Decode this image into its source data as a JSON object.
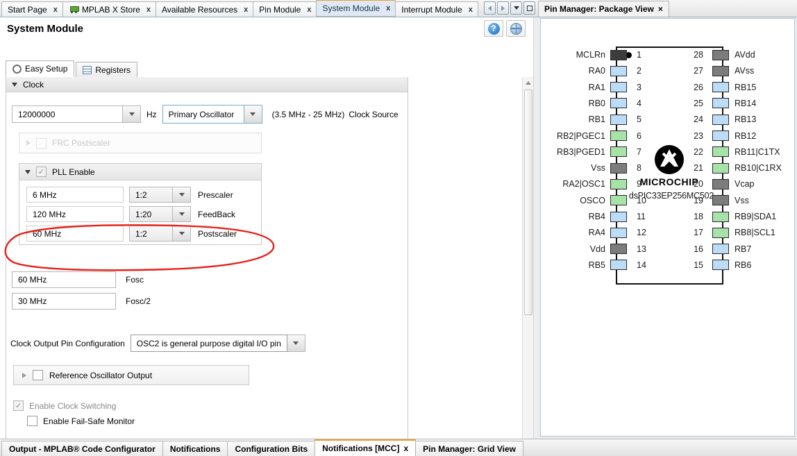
{
  "top_tabs": [
    {
      "label": "Start Page",
      "icon": "",
      "closable": true,
      "active": false
    },
    {
      "label": "MPLAB X Store",
      "icon": "cart-icon",
      "closable": true,
      "active": false
    },
    {
      "label": "Available Resources",
      "icon": "",
      "closable": true,
      "active": false
    },
    {
      "label": "Pin Module",
      "icon": "",
      "closable": true,
      "active": false
    },
    {
      "label": "System Module",
      "icon": "",
      "closable": true,
      "active": true
    },
    {
      "label": "Interrupt Module",
      "icon": "",
      "closable": true,
      "active": false
    }
  ],
  "tab_nav": {
    "back": "back-arrow-icon",
    "forward": "forward-arrow-icon",
    "list": "dropdown-list-icon",
    "maximize": "maximize-icon"
  },
  "editor": {
    "title": "System Module",
    "help_button": "?",
    "help_icon": "help-icon",
    "globe_icon": "globe-icon",
    "subtabs": [
      {
        "label": "Easy Setup",
        "icon": "gear-icon",
        "active": true
      },
      {
        "label": "Registers",
        "icon": "registers-icon",
        "active": false
      }
    ]
  },
  "clock": {
    "section_title": "Clock",
    "frequency_value": "12000000",
    "frequency_unit": "Hz",
    "clock_source_value": "Primary Oscillator",
    "clock_source_range": "(3.5 MHz - 25 MHz)",
    "clock_source_label": "Clock Source",
    "frc_postscaler_label": "FRC Postscaler",
    "frc_postscaler_enabled": false,
    "pll": {
      "label": "PLL Enable",
      "enabled": true,
      "rows": [
        {
          "freq": "6 MHz",
          "ratio": "1:2",
          "label": "Prescaler"
        },
        {
          "freq": "120 MHz",
          "ratio": "1:20",
          "label": "FeedBack"
        },
        {
          "freq": "60 MHz",
          "ratio": "1:2",
          "label": "Postscaler"
        }
      ]
    },
    "fosc_value": "60 MHz",
    "fosc_label": "Fosc",
    "fosc2_value": "30 MHz",
    "fosc2_label": "Fosc/2",
    "clock_output_label": "Clock Output Pin Configuration",
    "clock_output_value": "OSC2 is general purpose digital I/O pin",
    "reference_osc_label": "Reference Oscillator Output",
    "reference_osc_checked": false,
    "enable_clock_switching_label": "Enable Clock Switching",
    "enable_clock_switching_checked": true,
    "enable_fail_safe_label": "Enable Fail-Safe Monitor",
    "enable_fail_safe_checked": false
  },
  "annotation": {
    "shape": "red-ellipse",
    "color": "#e8201a",
    "targets": "Postscaler row"
  },
  "pin_manager": {
    "tab_label": "Pin Manager: Package View",
    "device_name": "dsPIC33EP256MC502",
    "brand": "MICROCHIP",
    "colors": {
      "power": "#7c7c7c",
      "power_dark": "#3c3c3c",
      "io": "#bcdcf8",
      "peripheral": "#a7e2a8"
    },
    "left_pins": [
      {
        "num": "1",
        "label": "MCLRn",
        "color": "#3c3c3c"
      },
      {
        "num": "2",
        "label": "RA0",
        "color": "#bcdcf8"
      },
      {
        "num": "3",
        "label": "RA1",
        "color": "#bcdcf8"
      },
      {
        "num": "4",
        "label": "RB0",
        "color": "#bcdcf8"
      },
      {
        "num": "5",
        "label": "RB1",
        "color": "#bcdcf8"
      },
      {
        "num": "6",
        "label": "RB2|PGEC1",
        "color": "#a7e2a8"
      },
      {
        "num": "7",
        "label": "RB3|PGED1",
        "color": "#a7e2a8"
      },
      {
        "num": "8",
        "label": "Vss",
        "color": "#7c7c7c"
      },
      {
        "num": "9",
        "label": "RA2|OSC1",
        "color": "#a7e2a8"
      },
      {
        "num": "10",
        "label": "OSCO",
        "color": "#a7e2a8"
      },
      {
        "num": "11",
        "label": "RB4",
        "color": "#bcdcf8"
      },
      {
        "num": "12",
        "label": "RA4",
        "color": "#bcdcf8"
      },
      {
        "num": "13",
        "label": "Vdd",
        "color": "#7c7c7c"
      },
      {
        "num": "14",
        "label": "RB5",
        "color": "#bcdcf8"
      }
    ],
    "right_pins": [
      {
        "num": "28",
        "label": "AVdd",
        "color": "#7c7c7c"
      },
      {
        "num": "27",
        "label": "AVss",
        "color": "#7c7c7c"
      },
      {
        "num": "26",
        "label": "RB15",
        "color": "#bcdcf8"
      },
      {
        "num": "25",
        "label": "RB14",
        "color": "#bcdcf8"
      },
      {
        "num": "24",
        "label": "RB13",
        "color": "#bcdcf8"
      },
      {
        "num": "23",
        "label": "RB12",
        "color": "#bcdcf8"
      },
      {
        "num": "22",
        "label": "RB11|C1TX",
        "color": "#a7e2a8"
      },
      {
        "num": "21",
        "label": "RB10|C1RX",
        "color": "#a7e2a8"
      },
      {
        "num": "20",
        "label": "Vcap",
        "color": "#7c7c7c"
      },
      {
        "num": "19",
        "label": "Vss",
        "color": "#7c7c7c"
      },
      {
        "num": "18",
        "label": "RB9|SDA1",
        "color": "#a7e2a8"
      },
      {
        "num": "17",
        "label": "RB8|SCL1",
        "color": "#a7e2a8"
      },
      {
        "num": "16",
        "label": "RB7",
        "color": "#bcdcf8"
      },
      {
        "num": "15",
        "label": "RB6",
        "color": "#bcdcf8"
      }
    ]
  },
  "bottom_tabs": [
    {
      "label": "Output - MPLAB® Code Configurator",
      "closable": false,
      "active": false
    },
    {
      "label": "Notifications",
      "closable": false,
      "active": false
    },
    {
      "label": "Configuration Bits",
      "closable": false,
      "active": false
    },
    {
      "label": "Notifications [MCC]",
      "closable": true,
      "active": true
    },
    {
      "label": "Pin Manager: Grid View",
      "closable": false,
      "active": false
    }
  ]
}
